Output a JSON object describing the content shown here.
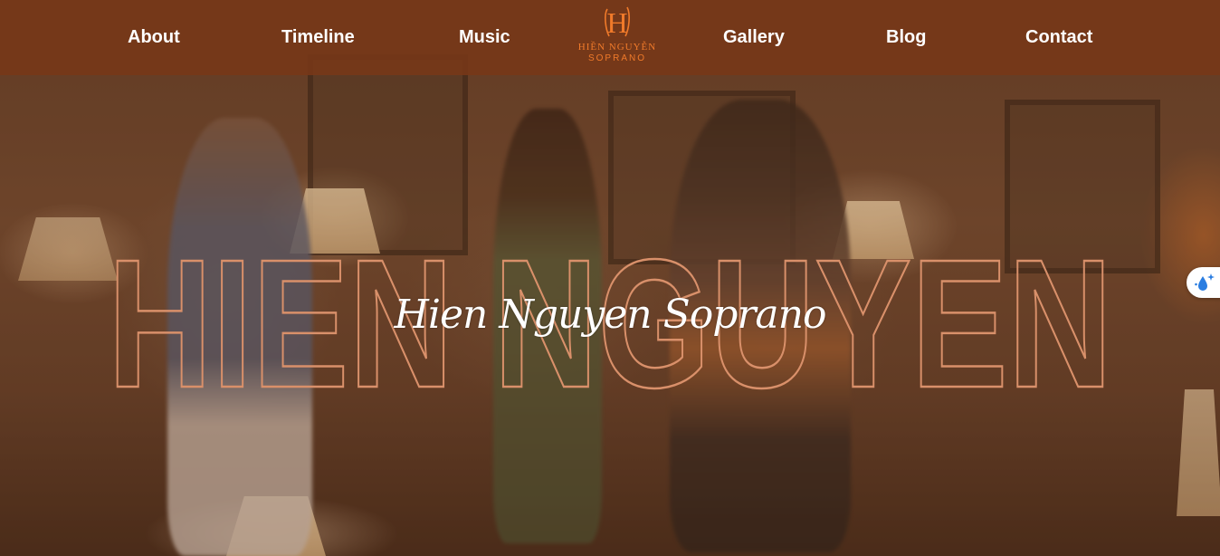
{
  "nav": {
    "items": [
      {
        "label": "About"
      },
      {
        "label": "Timeline"
      },
      {
        "label": "Music"
      },
      {
        "label": "Gallery"
      },
      {
        "label": "Blog"
      },
      {
        "label": "Contact"
      }
    ],
    "logo": {
      "monogram": "H",
      "name": "HIỀN NGUYỄN",
      "subtitle": "SOPRANO",
      "color": "#f07a2a"
    },
    "background": "#783818"
  },
  "hero": {
    "outline_title": "HIEN NGUYEN",
    "outline_color": "#d9906a",
    "script_title": "Hien Nguyen Soprano"
  },
  "widget": {
    "icon": "water-drop-sparkle-icon",
    "color": "#2a7de1"
  }
}
